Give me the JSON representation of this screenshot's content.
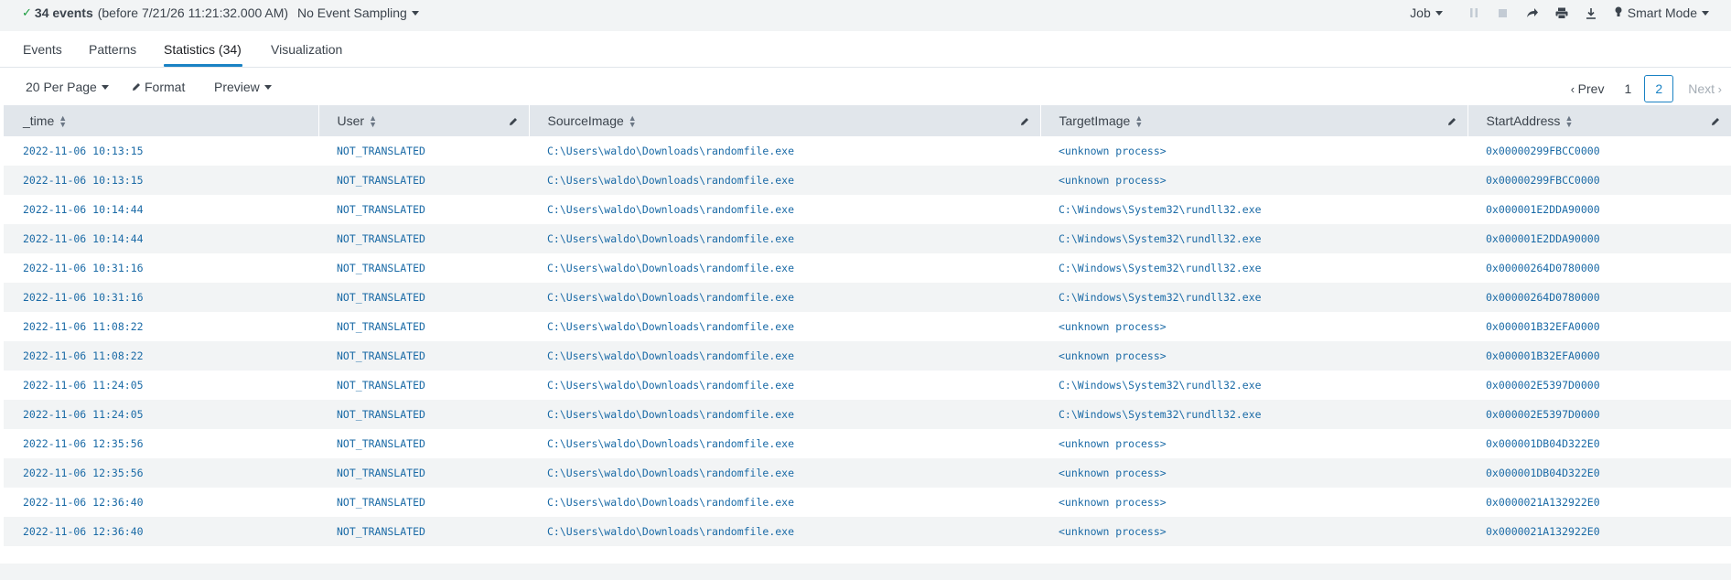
{
  "topbar": {
    "event_count": "34 events",
    "event_window": "(before 7/21/26 11:21:32.000 AM)",
    "sampling_label": "No Event Sampling",
    "job_label": "Job",
    "mode_label": "Smart Mode"
  },
  "tabs": [
    {
      "label": "Events"
    },
    {
      "label": "Patterns"
    },
    {
      "label": "Statistics (34)"
    },
    {
      "label": "Visualization"
    }
  ],
  "controls": {
    "per_page": "20 Per Page",
    "format": "Format",
    "preview": "Preview"
  },
  "pager": {
    "prev": "Prev",
    "page1": "1",
    "page2": "2",
    "next": "Next"
  },
  "table": {
    "columns": [
      "_time",
      "User",
      "SourceImage",
      "TargetImage",
      "StartAddress"
    ],
    "rows": [
      [
        "2022-11-06 10:13:15",
        "NOT_TRANSLATED",
        "C:\\Users\\waldo\\Downloads\\randomfile.exe",
        "<unknown process>",
        "0x00000299FBCC0000"
      ],
      [
        "2022-11-06 10:13:15",
        "NOT_TRANSLATED",
        "C:\\Users\\waldo\\Downloads\\randomfile.exe",
        "<unknown process>",
        "0x00000299FBCC0000"
      ],
      [
        "2022-11-06 10:14:44",
        "NOT_TRANSLATED",
        "C:\\Users\\waldo\\Downloads\\randomfile.exe",
        "C:\\Windows\\System32\\rundll32.exe",
        "0x000001E2DDA90000"
      ],
      [
        "2022-11-06 10:14:44",
        "NOT_TRANSLATED",
        "C:\\Users\\waldo\\Downloads\\randomfile.exe",
        "C:\\Windows\\System32\\rundll32.exe",
        "0x000001E2DDA90000"
      ],
      [
        "2022-11-06 10:31:16",
        "NOT_TRANSLATED",
        "C:\\Users\\waldo\\Downloads\\randomfile.exe",
        "C:\\Windows\\System32\\rundll32.exe",
        "0x00000264D0780000"
      ],
      [
        "2022-11-06 10:31:16",
        "NOT_TRANSLATED",
        "C:\\Users\\waldo\\Downloads\\randomfile.exe",
        "C:\\Windows\\System32\\rundll32.exe",
        "0x00000264D0780000"
      ],
      [
        "2022-11-06 11:08:22",
        "NOT_TRANSLATED",
        "C:\\Users\\waldo\\Downloads\\randomfile.exe",
        "<unknown process>",
        "0x000001B32EFA0000"
      ],
      [
        "2022-11-06 11:08:22",
        "NOT_TRANSLATED",
        "C:\\Users\\waldo\\Downloads\\randomfile.exe",
        "<unknown process>",
        "0x000001B32EFA0000"
      ],
      [
        "2022-11-06 11:24:05",
        "NOT_TRANSLATED",
        "C:\\Users\\waldo\\Downloads\\randomfile.exe",
        "C:\\Windows\\System32\\rundll32.exe",
        "0x000002E5397D0000"
      ],
      [
        "2022-11-06 11:24:05",
        "NOT_TRANSLATED",
        "C:\\Users\\waldo\\Downloads\\randomfile.exe",
        "C:\\Windows\\System32\\rundll32.exe",
        "0x000002E5397D0000"
      ],
      [
        "2022-11-06 12:35:56",
        "NOT_TRANSLATED",
        "C:\\Users\\waldo\\Downloads\\randomfile.exe",
        "<unknown process>",
        "0x000001DB04D322E0"
      ],
      [
        "2022-11-06 12:35:56",
        "NOT_TRANSLATED",
        "C:\\Users\\waldo\\Downloads\\randomfile.exe",
        "<unknown process>",
        "0x000001DB04D322E0"
      ],
      [
        "2022-11-06 12:36:40",
        "NOT_TRANSLATED",
        "C:\\Users\\waldo\\Downloads\\randomfile.exe",
        "<unknown process>",
        "0x0000021A132922E0"
      ],
      [
        "2022-11-06 12:36:40",
        "NOT_TRANSLATED",
        "C:\\Users\\waldo\\Downloads\\randomfile.exe",
        "<unknown process>",
        "0x0000021A132922E0"
      ]
    ]
  },
  "icons": {
    "status": "check-icon",
    "pause": "pause-icon",
    "stop": "stop-icon",
    "share": "share-icon",
    "print": "print-icon",
    "export": "download-icon",
    "mode": "lightbulb-icon",
    "sort": "sort-icon",
    "edit": "pencil-icon"
  },
  "colors": {
    "accent": "#1a82c4",
    "link": "#1a6aa6",
    "success": "#1a9c3e",
    "header_bg": "#e1e6eb",
    "stripe_bg": "#f2f4f5"
  }
}
